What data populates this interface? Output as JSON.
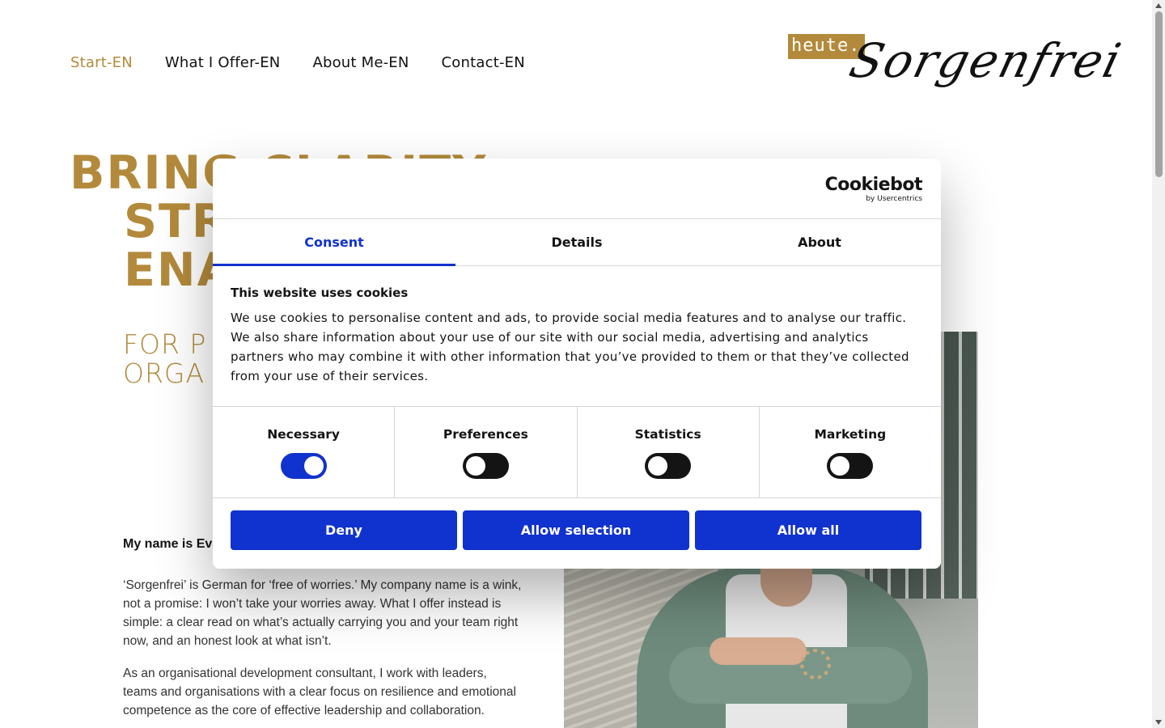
{
  "nav": {
    "items": [
      {
        "label": "Start-EN",
        "active": true
      },
      {
        "label": "What I Offer-EN",
        "active": false
      },
      {
        "label": "About Me-EN",
        "active": false
      },
      {
        "label": "Contact-EN",
        "active": false
      }
    ]
  },
  "logo": {
    "badge_text": "heute.",
    "script_text": "Sorgenfrei"
  },
  "hero": {
    "heading_line1": "BRING CLARITY",
    "heading_line2": "STR",
    "heading_line3": "ENA",
    "sub_line1": "FOR P",
    "sub_line2": "ORGA",
    "intro_name": "My name is Eva",
    "paragraph1": "‘Sorgenfrei’ is German for ‘free of worries.’ My company name is a wink, not a promise: I won’t take your worries away. What I offer instead is simple: a clear read on what’s actually carrying you and your team right now, and an honest look at what isn’t.",
    "paragraph2": "As an organisational development consultant, I work with leaders, teams and organisations with a clear focus on resilience and emotional competence as the core of effective leadership and collaboration."
  },
  "cookie_dialog": {
    "brand": "Cookiebot",
    "brand_sub": "by Usercentrics",
    "tabs": [
      {
        "label": "Consent",
        "active": true
      },
      {
        "label": "Details",
        "active": false
      },
      {
        "label": "About",
        "active": false
      }
    ],
    "title": "This website uses cookies",
    "text": "We use cookies to personalise content and ads, to provide social media features and to analyse our traffic. We also share information about your use of our site with our social media, advertising and analytics partners who may combine it with other information that you’ve provided to them or that they’ve collected from your use of their services.",
    "toggles": [
      {
        "label": "Necessary",
        "on": true
      },
      {
        "label": "Preferences",
        "on": false
      },
      {
        "label": "Statistics",
        "on": false
      },
      {
        "label": "Marketing",
        "on": false
      }
    ],
    "buttons": {
      "deny": "Deny",
      "allow_selection": "Allow selection",
      "allow_all": "Allow all"
    },
    "accent_color": "#1032cf"
  },
  "colors": {
    "brand_gold": "#b38a3b"
  }
}
